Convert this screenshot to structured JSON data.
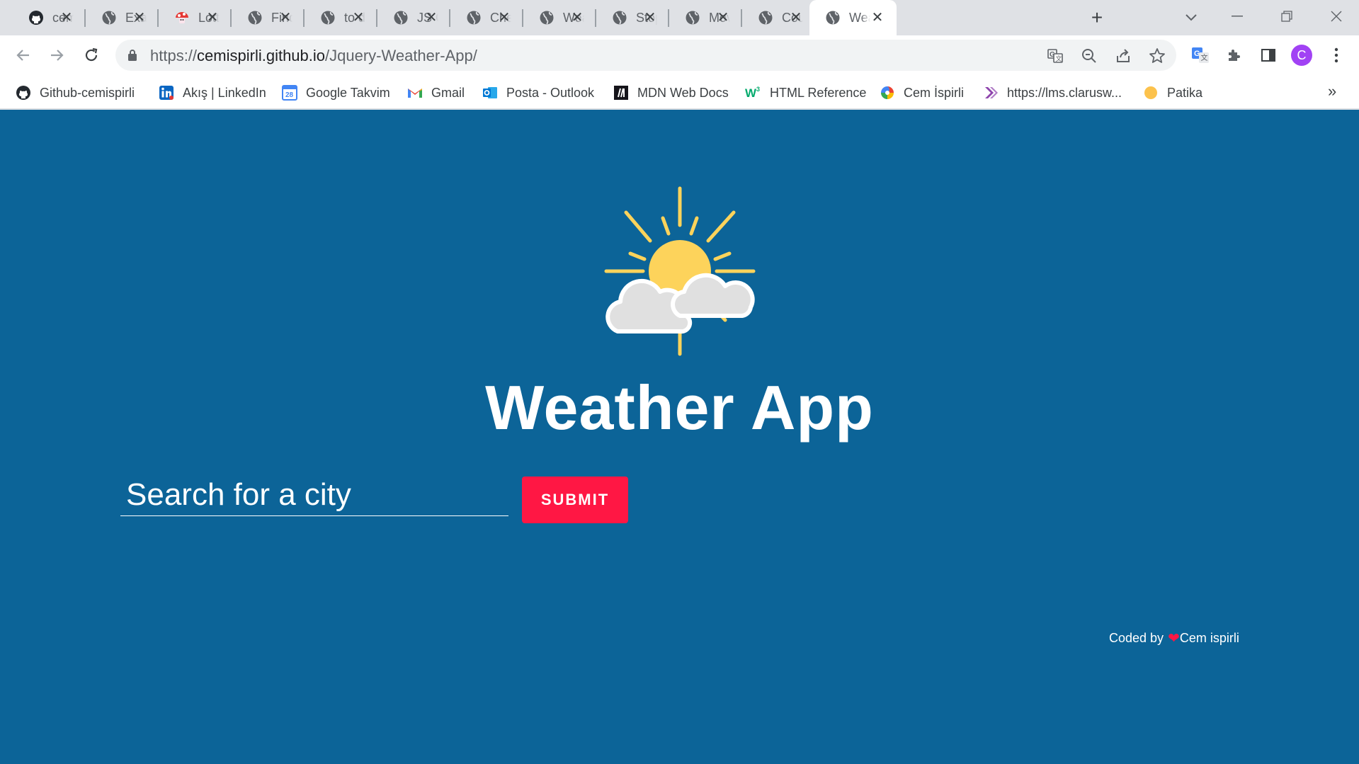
{
  "tabs": [
    {
      "title": "cemispirli",
      "icon": "github-icon"
    },
    {
      "title": "Example",
      "icon": "globe-icon"
    },
    {
      "title": "Lottery",
      "icon": "mushroom-icon"
    },
    {
      "title": "Find",
      "icon": "globe-icon"
    },
    {
      "title": "to do",
      "icon": "globe-icon"
    },
    {
      "title": "JS Calc",
      "icon": "globe-icon"
    },
    {
      "title": "Checkout",
      "icon": "globe-icon"
    },
    {
      "title": "Weather",
      "icon": "globe-icon"
    },
    {
      "title": "Stopwatch",
      "icon": "globe-icon"
    },
    {
      "title": "Movie",
      "icon": "globe-icon"
    },
    {
      "title": "Counter",
      "icon": "globe-icon"
    },
    {
      "title": "Weather App",
      "icon": "globe-icon",
      "active": true
    }
  ],
  "toolbar": {
    "url_scheme": "https://",
    "url_host": "cemispirli.github.io",
    "url_path": "/Jquery-Weather-App/",
    "avatar_letter": "C"
  },
  "bookmarks": [
    {
      "label": "Github-cemispirli",
      "icon": "github-icon"
    },
    {
      "label": "Akış | LinkedIn",
      "icon": "linkedin-icon"
    },
    {
      "label": "Google Takvim",
      "icon": "calendar-icon"
    },
    {
      "label": "Gmail",
      "icon": "gmail-icon"
    },
    {
      "label": "Posta - Outlook",
      "icon": "outlook-icon"
    },
    {
      "label": "MDN Web Docs",
      "icon": "mdn-icon"
    },
    {
      "label": "HTML Reference",
      "icon": "w3schools-icon"
    },
    {
      "label": "Cem İspirli",
      "icon": "swirl-icon"
    },
    {
      "label": "https://lms.clarusw...",
      "icon": "clarusway-icon"
    },
    {
      "label": "Patika",
      "icon": "patika-icon"
    }
  ],
  "calendar_badge": "28",
  "overflow_label": "»",
  "page": {
    "title": "Weather App",
    "search_placeholder": "Search for a city",
    "submit_label": "SUBMIT",
    "footer_prefix": "Coded by",
    "footer_name": "Cem ispirli",
    "colors": {
      "background": "#0c6498",
      "submit": "#ff1744",
      "sun": "#fdd35b",
      "cloud": "#e0e0e0"
    }
  }
}
